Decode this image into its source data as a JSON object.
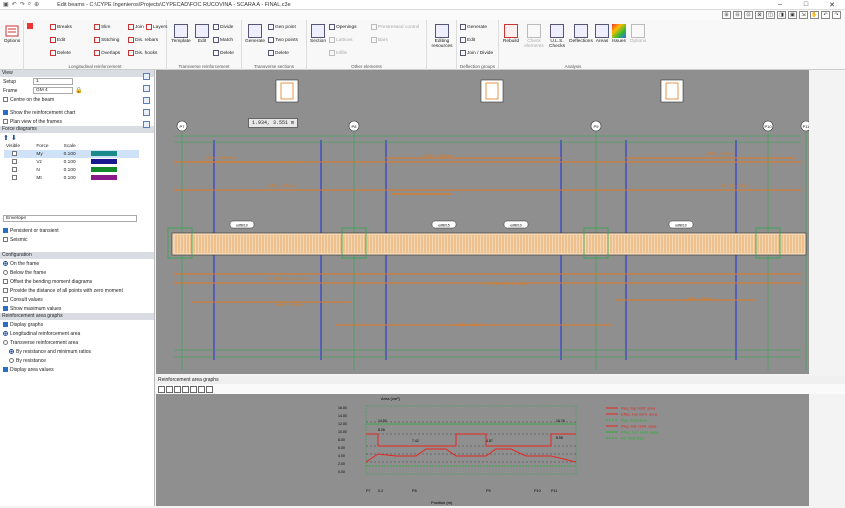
{
  "window": {
    "title": "Edit beams - C:\\CYPE Ingenieros\\Projects\\CYPECAD\\FOC RUCOVINA - SCARA A - FINAL.c3e",
    "qa_icons": [
      "save-icon",
      "undo-icon",
      "redo-icon",
      "search-icon",
      "zoom-icon"
    ],
    "controls": [
      "–",
      "□",
      "✕"
    ]
  },
  "toolbar2": [
    "⊞",
    "⊟",
    "⊡",
    "⊠",
    "◫",
    "◨",
    "▣",
    "⇲",
    "✋",
    "↶",
    "↷"
  ],
  "ribbon": {
    "options": {
      "label": "Options"
    },
    "longitudinal": {
      "group_label": "Longitudinal reinforcement",
      "buttons": [
        "Breaks",
        "Slim",
        "Join",
        "Layers",
        "Edit",
        "Stitching",
        "Dis. rebars",
        "Delete",
        "Overlaps",
        "Dis. hooks"
      ]
    },
    "transverse": {
      "group_label": "Transverse reinforcement",
      "big": [
        "Template",
        "Edit"
      ],
      "buttons": [
        "Divide",
        "Match",
        "Delete"
      ]
    },
    "sections": {
      "group_label": "Transverse sections",
      "big": [
        "Generate"
      ],
      "buttons": [
        "Gen point",
        "Two points",
        "Delete"
      ]
    },
    "other": {
      "group_label": "Other elements",
      "big": [
        "Section"
      ],
      "buttons": [
        "Openings",
        "Lattices",
        "Infills",
        "Prestressed control",
        "Bars"
      ]
    },
    "editing": {
      "label": "Editing resources"
    },
    "deflection": {
      "group_label": "Deflection groups",
      "buttons": [
        "Generate",
        "Edit",
        "Join / Divide"
      ]
    },
    "analysis": {
      "group_label": "Analysis",
      "big": [
        "Rebuild",
        "Check elements",
        "U.L.S. Checks",
        "Deflections",
        "Areas",
        "Issues",
        "Options"
      ]
    }
  },
  "panel": {
    "view": {
      "header": "View",
      "setup_label": "Setup",
      "setup_value": "1",
      "frame_label": "Frame",
      "frame_value": "GM 4",
      "centre_on_beam": "Centre on the beam",
      "show_reinforcement": "Show the reinforcement chart",
      "plan_view": "Plan view of the frames"
    },
    "force_diagrams": {
      "header": "Force diagrams",
      "columns": [
        "Visible",
        "Force",
        "Scale"
      ],
      "rows": [
        {
          "force": "My",
          "scale": "0.100",
          "color": "#1a8a8a",
          "visible": false
        },
        {
          "force": "Vz",
          "scale": "0.100",
          "color": "#1a1a8f",
          "visible": false
        },
        {
          "force": "N",
          "scale": "0.100",
          "color": "#128a2a",
          "visible": false
        },
        {
          "force": "Mt",
          "scale": "0.100",
          "color": "#8a1a8a",
          "visible": false
        }
      ],
      "envelope": "Envelope",
      "persistent": "Persistent or transient",
      "seismic": "Seismic"
    },
    "configuration": {
      "header": "Configuration",
      "on_frame": "On the frame",
      "below_frame": "Below the frame",
      "offset": "Offset the bending moment diagrams",
      "distance": "Provide the distance of all points with zero moment",
      "consult": "Consult values",
      "show_max": "Show maximum values"
    },
    "area_graphs": {
      "header": "Reinforcement area graphs",
      "display": "Display graphs",
      "longitudinal": "Longitudinal reinforcement area",
      "transverse": "Transverse reinforcement area",
      "by_res_min": "By resistance and minimum ratios",
      "by_res": "By resistance",
      "display_values": "Display area values"
    }
  },
  "viewport": {
    "tooltip": "1.934, 3.551 m",
    "columns": [
      "P7",
      "P8",
      "P9",
      "P10",
      "P11"
    ],
    "bar_labels": [
      "2Ø20 L=1134cm",
      "2Ø20 L=1230cm",
      "2Ø20 L=793cm",
      "2Ø16 L=945cm",
      "2Ø16 L=766cm",
      "2x1Ø16 Rdc4 L=341cm",
      "2x1Ø16 Rdc4 L=756cm",
      "4Ø16 L=735cm",
      "4Ø16 L=380cm",
      "4Ø16 L=796cm"
    ],
    "stirrups": [
      "eØ8/10",
      "eØ8/15",
      "eØ8/10",
      "eØ8/10",
      "eØ8/15"
    ]
  },
  "graph": {
    "header": "Reinforcement area graphs",
    "y_title": "Area (cm²)",
    "x_title": "Position (m)",
    "y_ticks": [
      "16.00",
      "14.00",
      "12.00",
      "10.00",
      "8.00",
      "6.00",
      "4.00",
      "2.00",
      "0.00"
    ],
    "x_ticks": [
      "P7",
      "0.2",
      "P8",
      "P9",
      "P10",
      "P11"
    ],
    "values": [
      "14.50",
      "8.26",
      "7.42",
      "4.57",
      "16.76",
      "8.58"
    ],
    "legend": [
      {
        "label": "Req. top reinf. area",
        "color": "#e8251f",
        "dashed": false
      },
      {
        "label": "Effec. top reinf. area",
        "color": "#e8251f",
        "dashed": false
      },
      {
        "label": "Sup. total area",
        "color": "#28b030",
        "dashed": true
      },
      {
        "label": "Req. bot. reinf. area",
        "color": "#e8251f",
        "dashed": false
      },
      {
        "label": "Effec. bot. reinf. area",
        "color": "#28b030",
        "dashed": false
      },
      {
        "label": "Inf. total area",
        "color": "#28b030",
        "dashed": true
      }
    ]
  }
}
